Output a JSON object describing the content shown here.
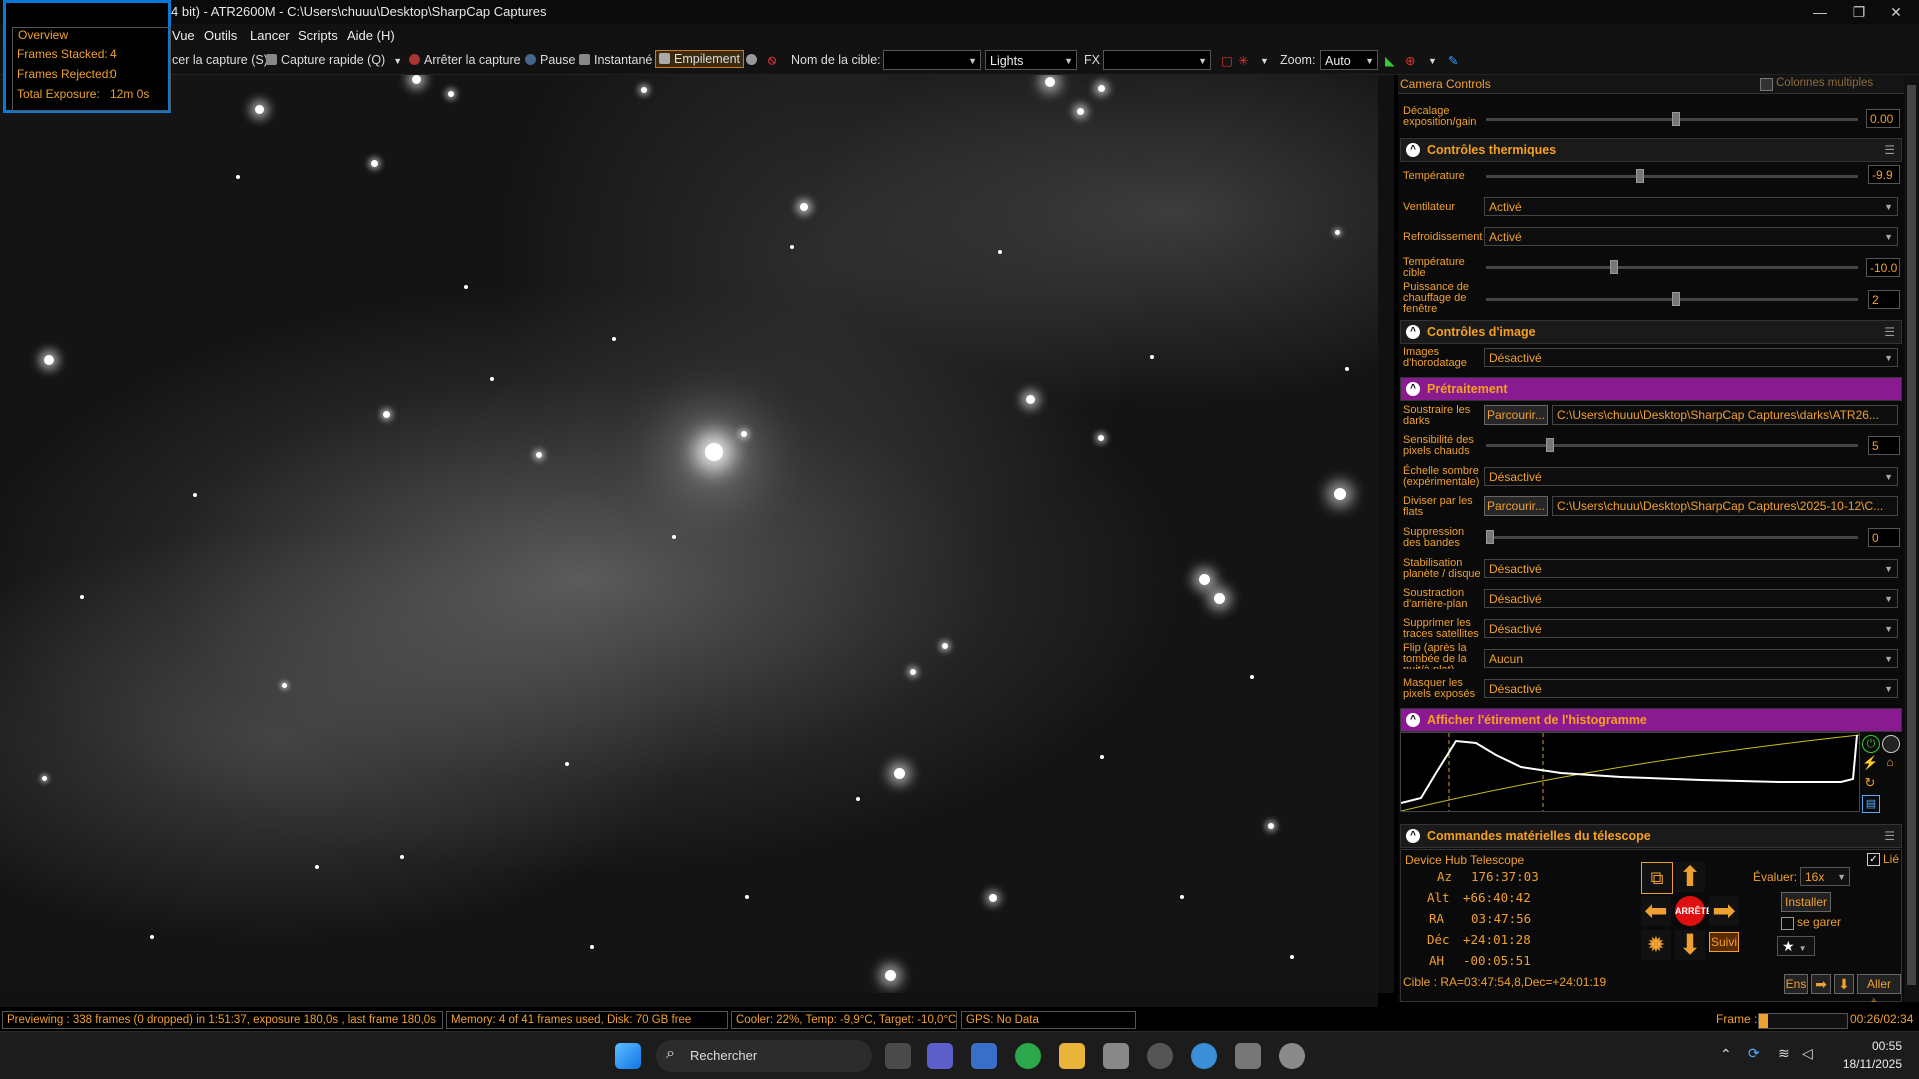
{
  "window": {
    "title": "4 bit) - ATR2600M - C:\\Users\\chuuu\\Desktop\\SharpCap Captures",
    "controls": [
      "—",
      "❐",
      "✕"
    ]
  },
  "menu": [
    "Vue",
    "Outils",
    "Lancer",
    "Scripts",
    "Aide (H)"
  ],
  "toolbar": {
    "start_capture": "cer la capture (S)",
    "quick_capture": "Capture rapide (Q)",
    "stop_capture": "Arrêter la capture",
    "pause": "Pause",
    "snapshot": "Instantané",
    "stacking": "Empilement",
    "target_label": "Nom de la cible:",
    "target_value": "",
    "frame_type": "Lights",
    "fx_label": "FX",
    "fx_value": "",
    "zoom_label": "Zoom:",
    "zoom_value": "Auto"
  },
  "overview": {
    "title": "Overview",
    "stacked_label": "Frames Stacked:",
    "stacked_value": "4",
    "rejected_label": "Frames Rejected:",
    "rejected_value": "0",
    "exposure_label": "Total Exposure:",
    "exposure_value": "12m 0s"
  },
  "panel": {
    "title": "Camera Controls",
    "multi_columns": "Colonnes multiples",
    "offset_label": "Décalage exposition/gain",
    "offset_value": "0.00",
    "thermal": {
      "title": "Contrôles thermiques",
      "temperature_label": "Température",
      "temperature_value": "-9.9",
      "fan_label": "Ventilateur",
      "fan_value": "Activé",
      "cooling_label": "Refroidissement",
      "cooling_value": "Activé",
      "target_temp_label": "Température cible",
      "target_temp_value": "-10.0",
      "heater_label": "Puissance de chauffage de fenêtre",
      "heater_value": "2"
    },
    "image": {
      "title": "Contrôles d'image",
      "timestamp_label": "Images d'horodatage",
      "timestamp_value": "Désactivé"
    },
    "preprocessing": {
      "title": "Prétraitement",
      "darks_label": "Soustraire les darks",
      "browse": "Parcourir...",
      "darks_path": "C:\\Users\\chuuu\\Desktop\\SharpCap Captures\\darks\\ATR26...",
      "hot_label": "Sensibilité des pixels chauds",
      "hot_value": "5",
      "dark_scale_label": "Échelle sombre (expérimentale)",
      "dark_scale_value": "Désactivé",
      "flats_label": "Diviser par les flats",
      "flats_path": "C:\\Users\\chuuu\\Desktop\\SharpCap Captures\\2025-10-12\\C...",
      "banding_label": "Suppression des bandes",
      "banding_value": "0",
      "stab_label": "Stabilisation planète / disque",
      "stab_value": "Désactivé",
      "bg_label": "Soustraction d'arrière-plan",
      "bg_value": "Désactivé",
      "sat_label": "Supprimer les traces satellites",
      "sat_value": "Désactivé",
      "flip_label": "Flip (après la tombée de la nuit/à plat)",
      "flip_value": "Aucun",
      "mask_label": "Masquer les pixels exposés",
      "mask_value": "Désactivé"
    },
    "histogram": {
      "title": "Afficher l'étirement de l'histogramme"
    },
    "telescope": {
      "title": "Commandes matérielles du télescope",
      "device": "Device Hub Telescope",
      "linked": "Lié",
      "az_label": "Az",
      "az": "176:37:03",
      "alt_label": "Alt",
      "alt": "+66:40:42",
      "ra_label": "RA",
      "ra": "03:47:56",
      "dec_label": "Déc",
      "dec": "+24:01:28",
      "ah_label": "AH",
      "ah": "-00:05:51",
      "rate_label": "Évaluer:",
      "rate_value": "16x",
      "install": "Installer",
      "park": "se garer",
      "stop": "ARRÊTE",
      "track": "Suivi",
      "target": "Cible : RA=03:47:54,8,Dec=+24:01:19",
      "sync": "Ens",
      "goto": "Aller à..."
    }
  },
  "status": {
    "preview": "Previewing : 338 frames (0 dropped) in 1:51:37, exposure 180,0s , last frame 180,0s",
    "memory": "Memory: 4 of 41 frames used, Disk: 70 GB free",
    "cooler": "Cooler: 22%, Temp: -9,9°C, Target: -10,0°C",
    "gps": "GPS: No Data",
    "frame_label": "Frame :",
    "frame_time": "00:26/02:34",
    "frame_progress": 0.1
  },
  "taskbar": {
    "search": "Rechercher",
    "time": "00:55",
    "date": "18/11/2025"
  },
  "colors": {
    "accent_orange": "#f0a030",
    "purple_header": "#8a1a8f",
    "overview_border": "#0a78d7"
  }
}
